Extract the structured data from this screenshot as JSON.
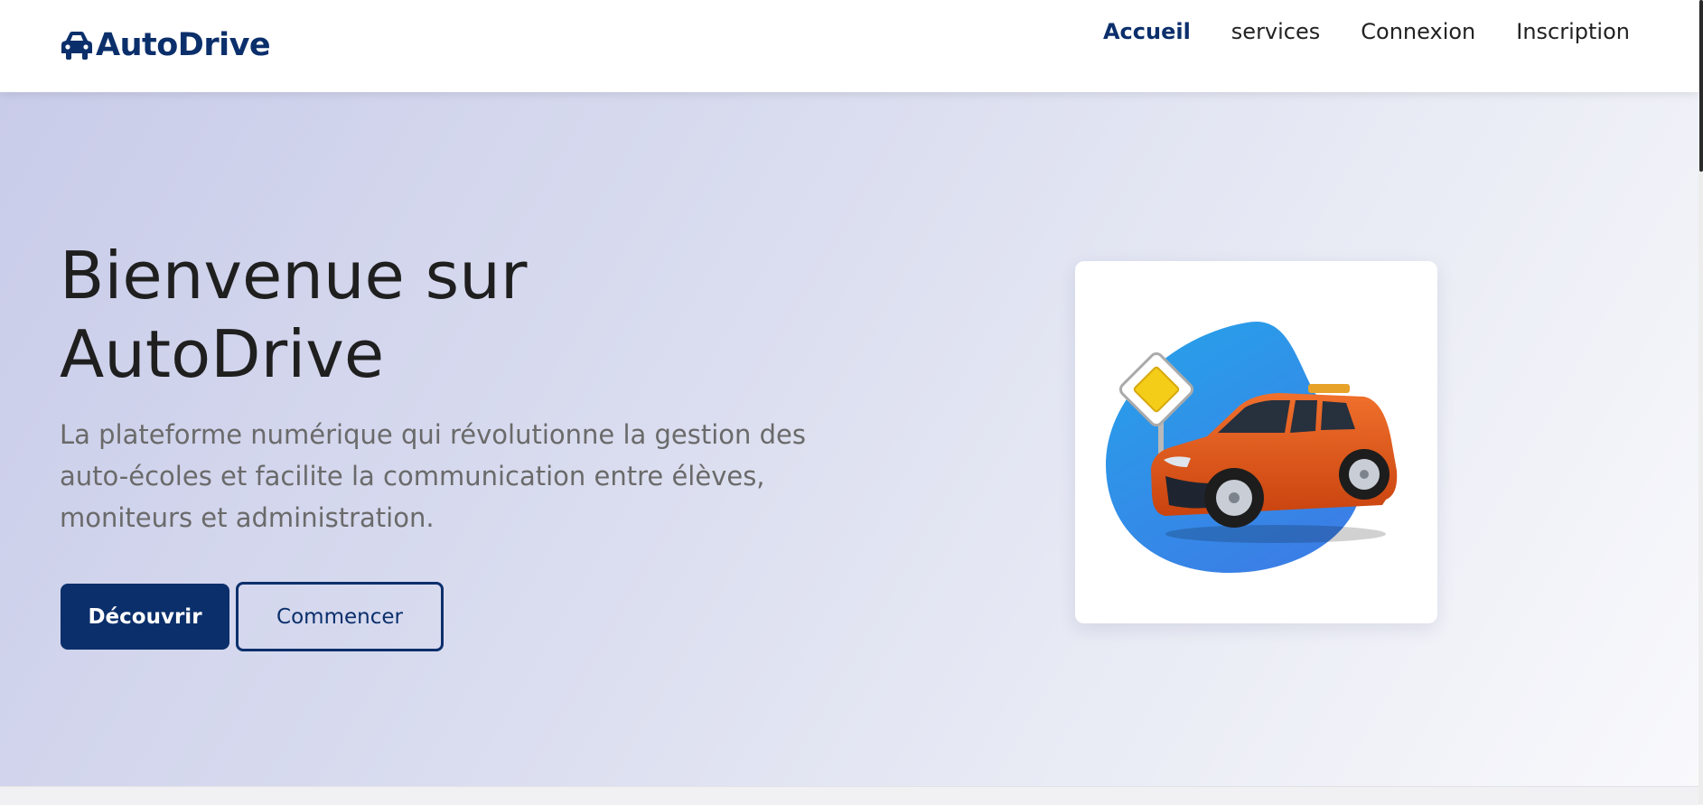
{
  "nav": {
    "brand": "AutoDrive",
    "brand_icon": "car-icon",
    "links": [
      {
        "label": "Accueil",
        "active": true
      },
      {
        "label": "services",
        "active": false
      },
      {
        "label": "Connexion",
        "active": false
      },
      {
        "label": "Inscription",
        "active": false
      }
    ]
  },
  "hero": {
    "title_line1": "Bienvenue sur",
    "title_line2": "AutoDrive",
    "description": "La plateforme numérique qui révolutionne la gestion des auto-écoles et facilite la communication entre élèves, moniteurs et administration.",
    "primary_button": "Découvrir",
    "secondary_button": "Commencer",
    "image_icon": "driving-school-car-illustration"
  },
  "colors": {
    "brand": "#0b2f6b",
    "car_orange": "#e05a1e",
    "blob_blue": "#2f86e6"
  }
}
